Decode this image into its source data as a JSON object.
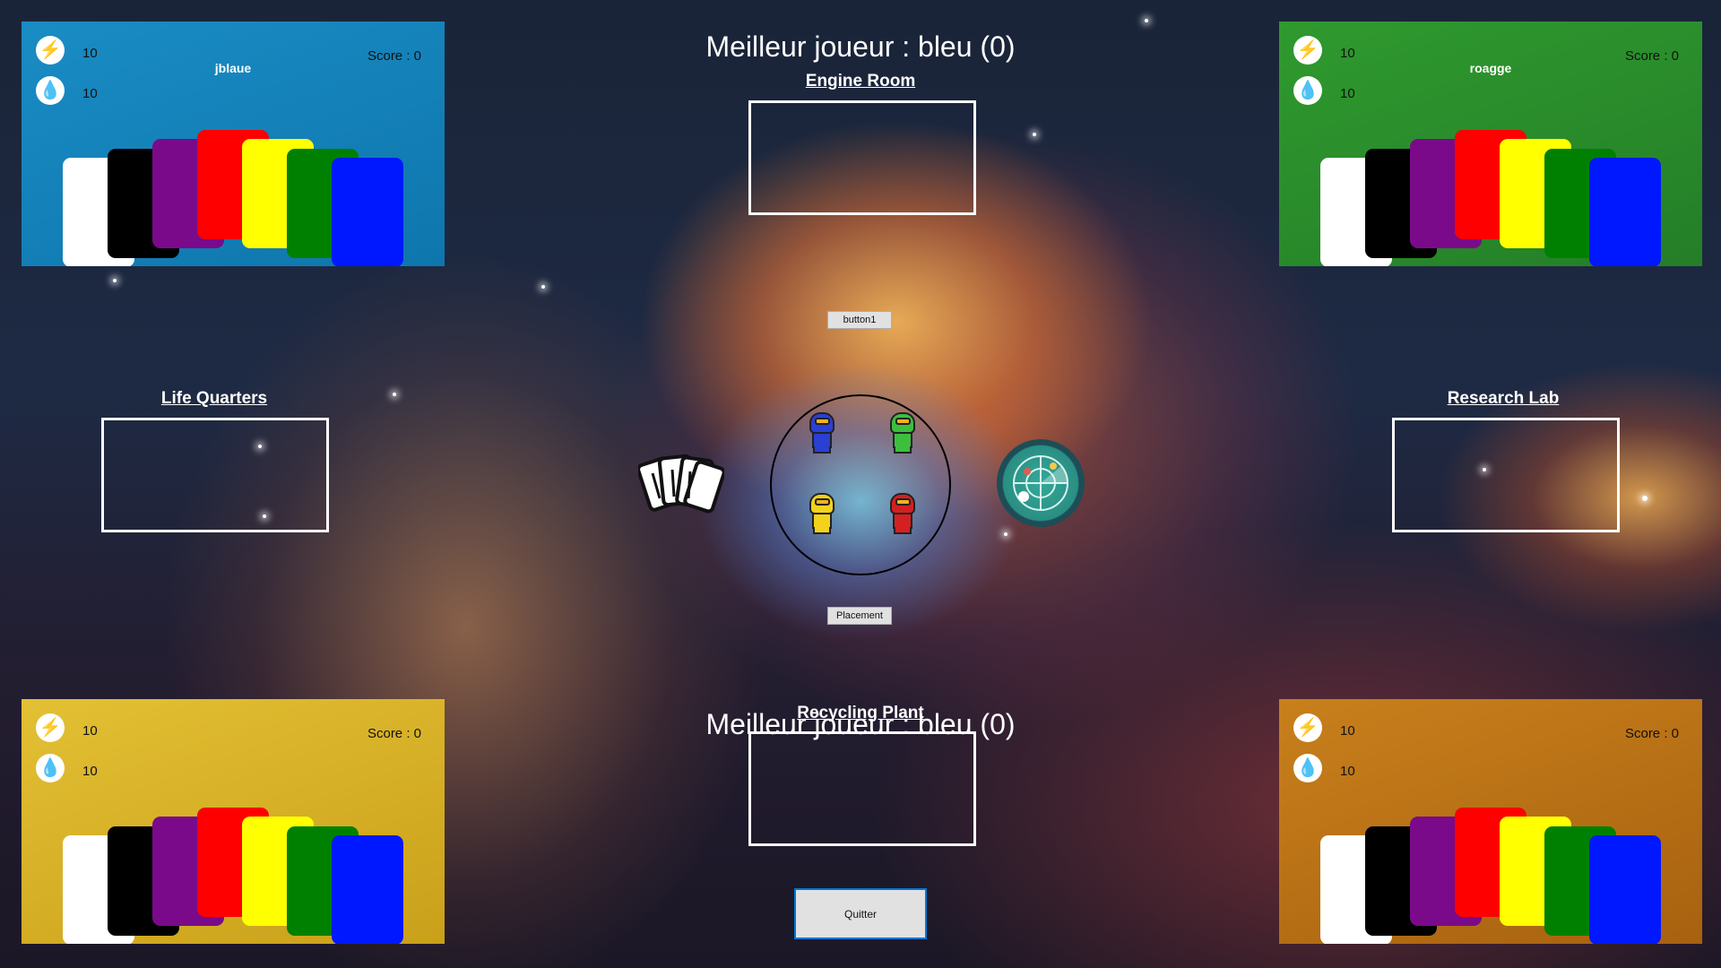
{
  "header": {
    "best_player_top": "Meilleur joueur : bleu (0)",
    "best_player_bottom": "Meilleur joueur : bleu (0)"
  },
  "rooms": {
    "engine_room": "Engine Room",
    "life_quarters": "Life Quarters",
    "research_lab": "Research Lab",
    "recycling_plant": "Recycling Plant"
  },
  "buttons": {
    "button1": "button1",
    "placement": "Placement",
    "quit": "Quitter"
  },
  "players": {
    "blue": {
      "name": "jblaue",
      "energy": "10",
      "water": "10",
      "score": "Score : 0",
      "color": "#1a8cc4"
    },
    "green": {
      "name": "roagge",
      "energy": "10",
      "water": "10",
      "score": "Score : 0",
      "color": "#2f9a2e"
    },
    "yellow": {
      "name": "",
      "energy": "10",
      "water": "10",
      "score": "Score : 0",
      "color": "#e3c034"
    },
    "orange": {
      "name": "",
      "energy": "10",
      "water": "10",
      "score": "Score : 0",
      "color": "#c8801c"
    }
  },
  "card_colors": [
    "#ffffff",
    "#000000",
    "#7a0a8a",
    "#ff0000",
    "#ffff00",
    "#008000",
    "#0018ff"
  ],
  "icons": {
    "energy": "lightning-icon",
    "water": "water-drop-icon",
    "deck": "cards-icon",
    "radar": "radar-icon"
  }
}
